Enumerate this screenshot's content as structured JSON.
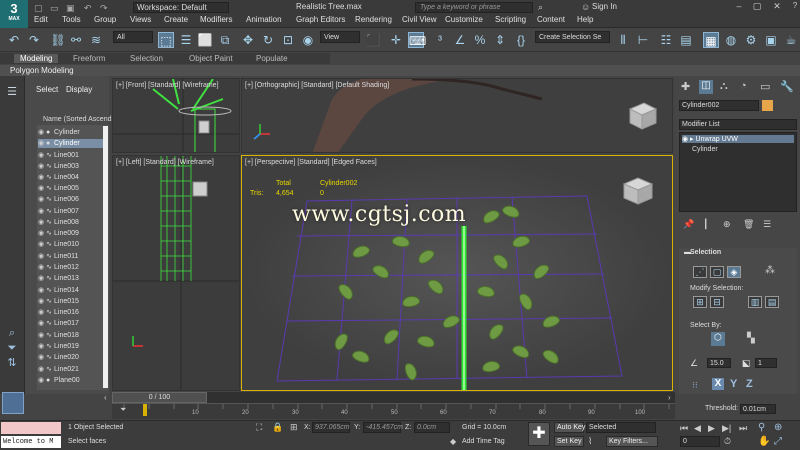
{
  "app": {
    "logo": "3",
    "logo_sub": "MAX",
    "workspace": "Workspace: Default",
    "file_title": "Realistic Tree.max",
    "search_placeholder": "Type a keyword or phrase",
    "signin": "Sign In"
  },
  "menu": [
    "Edit",
    "Tools",
    "Group",
    "Views",
    "Create",
    "Modifiers",
    "Animation",
    "Graph Editors",
    "Rendering",
    "Civil View",
    "Customize",
    "Scripting",
    "Content",
    "Help"
  ],
  "toolbar": {
    "filter_all": "All",
    "view_dropdown": "View",
    "selection_set": "Create Selection Se"
  },
  "ribbon": {
    "tabs": [
      "Modeling",
      "Freeform",
      "Selection",
      "Object Paint",
      "Populate"
    ],
    "subtab": "Polygon Modeling"
  },
  "explorer": {
    "tabs": [
      "Select",
      "Display"
    ],
    "column_header": "Name (Sorted Ascend",
    "rows": [
      "Cylinder",
      "Cylinder",
      "Line001",
      "Line003",
      "Line004",
      "Line005",
      "Line006",
      "Line007",
      "Line008",
      "Line009",
      "Line010",
      "Line011",
      "Line012",
      "Line013",
      "Line014",
      "Line015",
      "Line016",
      "Line017",
      "Line018",
      "Line019",
      "Line020",
      "Line021",
      "Plane00"
    ]
  },
  "viewports": {
    "front": "[+] [Front] [Standard] [Wireframe]",
    "ortho": "[+] [Orthographic] [Standard] [Default Shading]",
    "left": "[+] [Left] [Standard] [Wireframe]",
    "persp": "[+] [Perspective] [Standard] [Edged Faces]",
    "stats": {
      "total_label": "Total",
      "object_label": "Cylinder002",
      "tris_label": "Tris:",
      "tris_total": "4,654",
      "tris_object": "0"
    }
  },
  "command_panel": {
    "object_name": "Cylinder002",
    "object_color": "#e8a64a",
    "modifier_list": "Modifier List",
    "stack": [
      "Unwrap UVW",
      "Cylinder"
    ],
    "selection_title": "Selection",
    "modify_selection": "Modify Selection:",
    "select_by": "Select By:",
    "angle_value": "15.0",
    "count_value": "1",
    "xyz": [
      "X",
      "Y",
      "Z"
    ],
    "threshold_label": "Threshold:",
    "threshold_value": "0.01cm"
  },
  "timeline": {
    "position": "0 / 100",
    "ticks": [
      "10",
      "20",
      "30",
      "40",
      "50",
      "60",
      "70",
      "80",
      "90",
      "100"
    ]
  },
  "status": {
    "maxscript": "Welcome to M",
    "selected_count": "1 Object Selected",
    "prompt": "Select faces",
    "x_coord": "937.065cm",
    "y_coord": "-415.457cm",
    "z_coord": "0.0cm",
    "grid": "Grid = 10.0cm",
    "add_time_tag": "Add Time Tag",
    "auto_key": "Auto Key",
    "set_key": "Set Key",
    "selected_dropdown": "Selected",
    "key_filters": "Key Filters...",
    "frame": "0"
  },
  "watermark": "www.cgtsj.com"
}
